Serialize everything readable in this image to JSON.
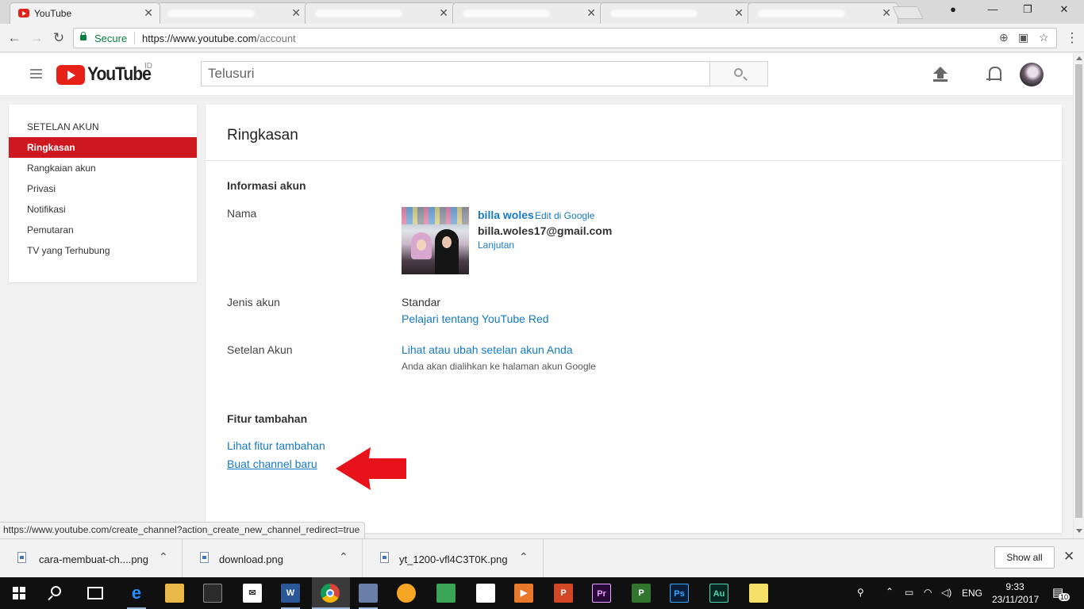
{
  "browser": {
    "tabs": [
      {
        "title": "YouTube",
        "active": true
      },
      {
        "title": "",
        "active": false
      },
      {
        "title": "",
        "active": false
      },
      {
        "title": "",
        "active": false
      },
      {
        "title": "",
        "active": false
      },
      {
        "title": "",
        "active": false
      }
    ],
    "security_label": "Secure",
    "url_prefix": "https://www.youtube.com",
    "url_path": "/account",
    "status_url": "https://www.youtube.com/create_channel?action_create_new_channel_redirect=true"
  },
  "header": {
    "logo_text": "YouTube",
    "region": "ID",
    "search_placeholder": "Telusuri"
  },
  "sidebar": {
    "heading": "SETELAN AKUN",
    "items": [
      {
        "label": "Ringkasan",
        "active": true
      },
      {
        "label": "Rangkaian akun",
        "active": false
      },
      {
        "label": "Privasi",
        "active": false
      },
      {
        "label": "Notifikasi",
        "active": false
      },
      {
        "label": "Pemutaran",
        "active": false
      },
      {
        "label": "TV yang Terhubung",
        "active": false
      }
    ]
  },
  "main": {
    "title": "Ringkasan",
    "account_info": {
      "heading": "Informasi akun",
      "name_label": "Nama",
      "display_name": "billa woles",
      "edit_link": "Edit di Google",
      "email": "billa.woles17@gmail.com",
      "advanced_link": "Lanjutan",
      "type_label": "Jenis akun",
      "type_value": "Standar",
      "red_link": "Pelajari tentang YouTube Red",
      "settings_label": "Setelan Akun",
      "settings_link": "Lihat atau ubah setelan akun Anda",
      "settings_hint": "Anda akan dialihkan ke halaman akun Google"
    },
    "extra_features": {
      "heading": "Fitur tambahan",
      "view_link": "Lihat fitur tambahan",
      "create_channel_link": "Buat channel baru"
    }
  },
  "downloads": {
    "items": [
      {
        "name": "cara-membuat-ch....png"
      },
      {
        "name": "download.png"
      },
      {
        "name": "yt_1200-vfl4C3T0K.png"
      }
    ],
    "show_all": "Show all"
  },
  "taskbar": {
    "language": "ENG",
    "time": "9:33",
    "date": "23/11/2017",
    "notification_count": "10"
  },
  "colors": {
    "youtube_red": "#e62117",
    "sidebar_active": "#cc181e",
    "link_blue": "#167ac6",
    "arrow_red": "#e8121b"
  },
  "icons": [
    "back-icon",
    "forward-icon",
    "reload-icon",
    "lock-icon",
    "zoom-icon",
    "translate-icon",
    "star-icon",
    "menu-icon",
    "search-icon",
    "upload-icon",
    "bell-icon",
    "file-icon",
    "windows-icon",
    "chrome-icon"
  ]
}
